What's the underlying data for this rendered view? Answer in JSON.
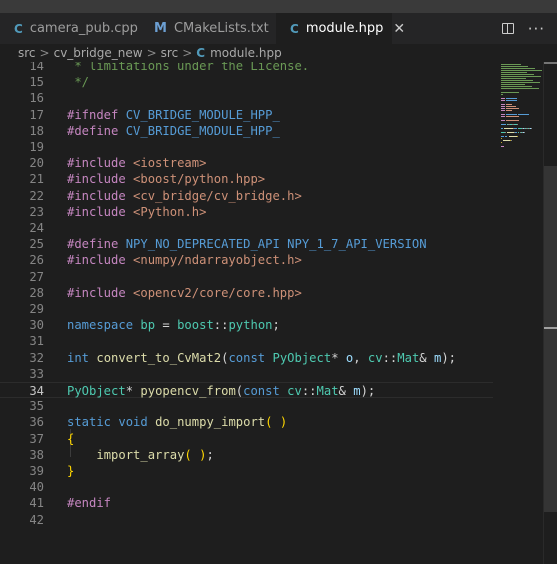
{
  "tabs": [
    {
      "icon": "C",
      "label": "camera_pub.cpp",
      "active": false
    },
    {
      "icon": "M",
      "label": "CMakeLists.txt",
      "active": false
    },
    {
      "icon": "C",
      "label": "module.hpp",
      "active": true
    }
  ],
  "tab_close_glyph": "✕",
  "actions": {
    "split_icon": "split-editor-icon",
    "more_glyph": "···"
  },
  "breadcrumb": {
    "items": [
      "src",
      "cv_bridge_new",
      "src"
    ],
    "separator": ">",
    "file_icon": "C",
    "file": "module.hpp"
  },
  "editor": {
    "current_line": 34,
    "lines": [
      {
        "n": "14",
        "tokens": [
          {
            "t": " * limitations under the License.",
            "c": "cm"
          }
        ]
      },
      {
        "n": "15",
        "tokens": [
          {
            "t": " */",
            "c": "cm"
          }
        ]
      },
      {
        "n": "16",
        "tokens": []
      },
      {
        "n": "17",
        "tokens": [
          {
            "t": "#ifndef",
            "c": "pp"
          },
          {
            "t": " ",
            "c": "pl"
          },
          {
            "t": "CV_BRIDGE_MODULE_HPP_",
            "c": "mac"
          }
        ]
      },
      {
        "n": "18",
        "tokens": [
          {
            "t": "#define",
            "c": "pp"
          },
          {
            "t": " ",
            "c": "pl"
          },
          {
            "t": "CV_BRIDGE_MODULE_HPP_",
            "c": "mac"
          }
        ]
      },
      {
        "n": "19",
        "tokens": []
      },
      {
        "n": "20",
        "tokens": [
          {
            "t": "#include",
            "c": "pp"
          },
          {
            "t": " ",
            "c": "pl"
          },
          {
            "t": "<iostream>",
            "c": "str"
          }
        ]
      },
      {
        "n": "21",
        "tokens": [
          {
            "t": "#include",
            "c": "pp"
          },
          {
            "t": " ",
            "c": "pl"
          },
          {
            "t": "<boost/python.hpp>",
            "c": "str"
          }
        ]
      },
      {
        "n": "22",
        "tokens": [
          {
            "t": "#include",
            "c": "pp"
          },
          {
            "t": " ",
            "c": "pl"
          },
          {
            "t": "<cv_bridge/cv_bridge.h>",
            "c": "str"
          }
        ]
      },
      {
        "n": "23",
        "tokens": [
          {
            "t": "#include",
            "c": "pp"
          },
          {
            "t": " ",
            "c": "pl"
          },
          {
            "t": "<Python.h>",
            "c": "str"
          }
        ]
      },
      {
        "n": "24",
        "tokens": []
      },
      {
        "n": "25",
        "tokens": [
          {
            "t": "#define",
            "c": "pp"
          },
          {
            "t": " ",
            "c": "pl"
          },
          {
            "t": "NPY_NO_DEPRECATED_API",
            "c": "mac"
          },
          {
            "t": " ",
            "c": "pl"
          },
          {
            "t": "NPY_1_7_API_VERSION",
            "c": "mac"
          }
        ]
      },
      {
        "n": "26",
        "tokens": [
          {
            "t": "#include",
            "c": "pp"
          },
          {
            "t": " ",
            "c": "pl"
          },
          {
            "t": "<numpy/ndarrayobject.h>",
            "c": "str"
          }
        ]
      },
      {
        "n": "27",
        "tokens": []
      },
      {
        "n": "28",
        "tokens": [
          {
            "t": "#include",
            "c": "pp"
          },
          {
            "t": " ",
            "c": "pl"
          },
          {
            "t": "<opencv2/core/core.hpp>",
            "c": "str"
          }
        ]
      },
      {
        "n": "29",
        "tokens": []
      },
      {
        "n": "30",
        "tokens": [
          {
            "t": "namespace",
            "c": "kw"
          },
          {
            "t": " ",
            "c": "pl"
          },
          {
            "t": "bp",
            "c": "ty"
          },
          {
            "t": " = ",
            "c": "pl"
          },
          {
            "t": "boost",
            "c": "ty"
          },
          {
            "t": "::",
            "c": "pl"
          },
          {
            "t": "python",
            "c": "ty"
          },
          {
            "t": ";",
            "c": "pl"
          }
        ]
      },
      {
        "n": "31",
        "tokens": []
      },
      {
        "n": "32",
        "tokens": [
          {
            "t": "int",
            "c": "kw"
          },
          {
            "t": " ",
            "c": "pl"
          },
          {
            "t": "convert_to_CvMat2",
            "c": "fn"
          },
          {
            "t": "(",
            "c": "pl"
          },
          {
            "t": "const",
            "c": "kw"
          },
          {
            "t": " ",
            "c": "pl"
          },
          {
            "t": "PyObject",
            "c": "ty"
          },
          {
            "t": "* ",
            "c": "pl"
          },
          {
            "t": "o",
            "c": "var"
          },
          {
            "t": ", ",
            "c": "pl"
          },
          {
            "t": "cv",
            "c": "ty"
          },
          {
            "t": "::",
            "c": "pl"
          },
          {
            "t": "Mat",
            "c": "ty"
          },
          {
            "t": "& ",
            "c": "pl"
          },
          {
            "t": "m",
            "c": "var"
          },
          {
            "t": ");",
            "c": "pl"
          }
        ]
      },
      {
        "n": "33",
        "tokens": []
      },
      {
        "n": "34",
        "tokens": [
          {
            "t": "PyObject",
            "c": "ty"
          },
          {
            "t": "* ",
            "c": "pl"
          },
          {
            "t": "pyopencv_from",
            "c": "fn"
          },
          {
            "t": "(",
            "c": "pl"
          },
          {
            "t": "const",
            "c": "kw"
          },
          {
            "t": " ",
            "c": "pl"
          },
          {
            "t": "cv",
            "c": "ty"
          },
          {
            "t": "::",
            "c": "pl"
          },
          {
            "t": "Mat",
            "c": "ty"
          },
          {
            "t": "& ",
            "c": "pl"
          },
          {
            "t": "m",
            "c": "var"
          },
          {
            "t": ");",
            "c": "pl"
          }
        ]
      },
      {
        "n": "35",
        "tokens": []
      },
      {
        "n": "36",
        "tokens": [
          {
            "t": "static",
            "c": "kw"
          },
          {
            "t": " ",
            "c": "pl"
          },
          {
            "t": "void",
            "c": "kw"
          },
          {
            "t": " ",
            "c": "pl"
          },
          {
            "t": "do_numpy_import",
            "c": "fn"
          },
          {
            "t": "( )",
            "c": "br"
          }
        ]
      },
      {
        "n": "37",
        "tokens": [
          {
            "t": "{",
            "c": "br"
          }
        ]
      },
      {
        "n": "38",
        "tokens": [
          {
            "t": "    ",
            "c": "pl"
          },
          {
            "t": "import_array",
            "c": "fn"
          },
          {
            "t": "( )",
            "c": "br"
          },
          {
            "t": ";",
            "c": "pl"
          }
        ]
      },
      {
        "n": "39",
        "tokens": [
          {
            "t": "}",
            "c": "br"
          }
        ]
      },
      {
        "n": "40",
        "tokens": []
      },
      {
        "n": "41",
        "tokens": [
          {
            "t": "#endif",
            "c": "pp"
          }
        ]
      },
      {
        "n": "42",
        "tokens": []
      }
    ]
  },
  "colors": {
    "editor_bg": "#1e1e1e",
    "tabbar_bg": "#252526",
    "comment": "#6a9955",
    "preprocessor": "#c586c0",
    "keyword": "#569cd6",
    "string": "#ce9178",
    "type": "#4ec9b0",
    "function": "#dcdcaa",
    "variable": "#9cdcfe",
    "bracket": "#ffd700"
  }
}
